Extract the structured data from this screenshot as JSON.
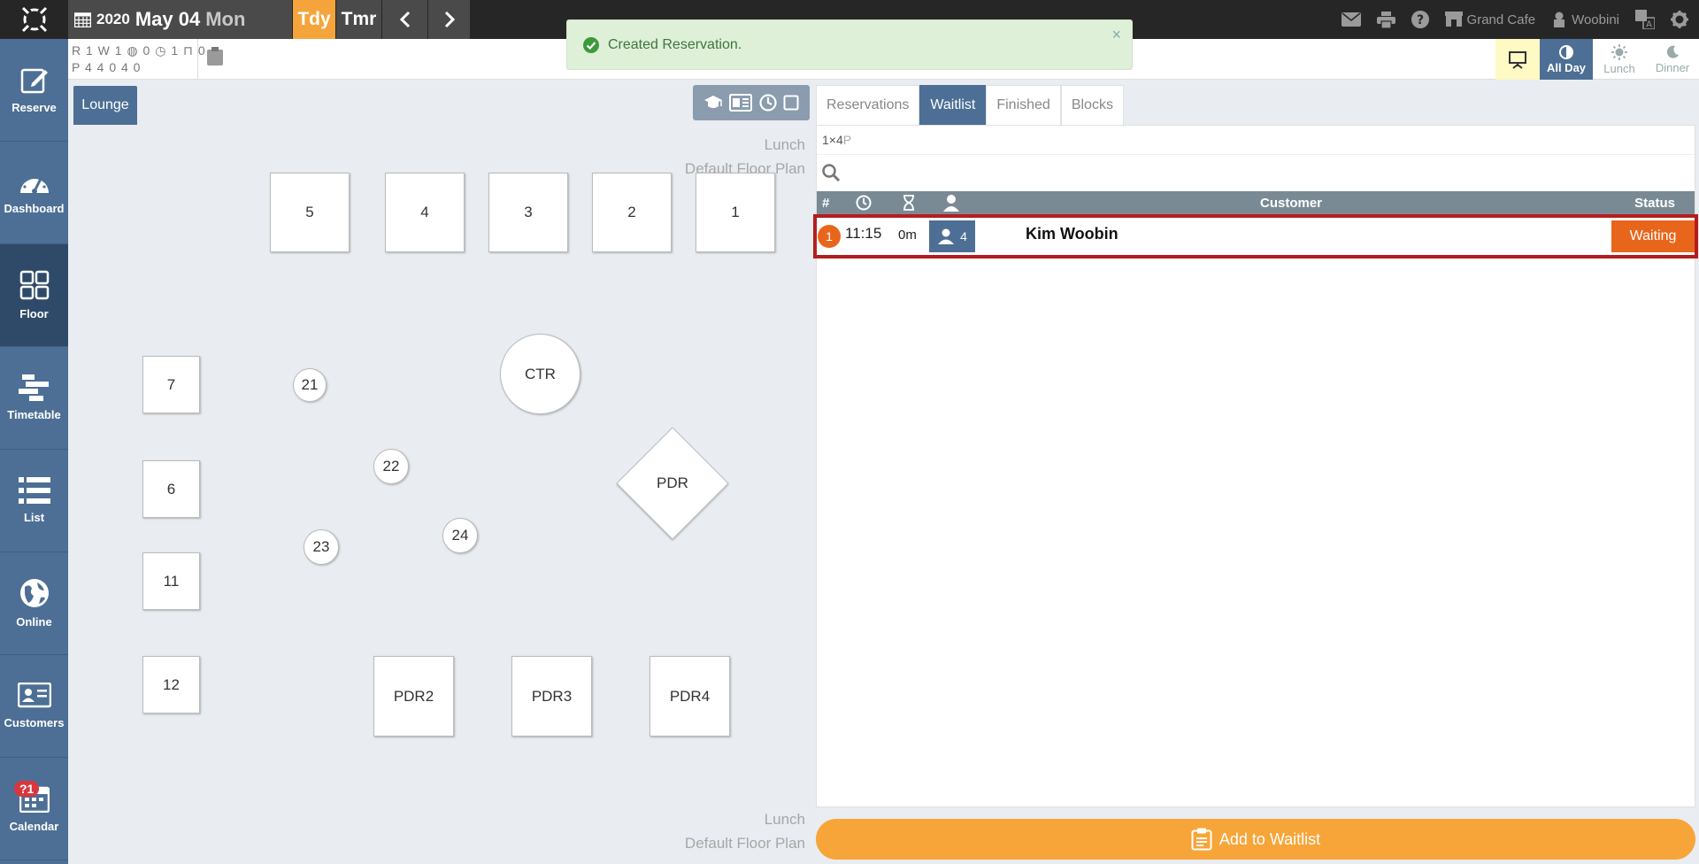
{
  "topbar": {
    "year": "2020",
    "month_day": "May 04",
    "weekday": "Mon",
    "today_label": "Tdy",
    "tomorrow_label": "Tmr",
    "restaurant": "Grand Cafe",
    "user": "Woobini"
  },
  "toast": {
    "message": "Created Reservation.",
    "close": "×"
  },
  "stats": {
    "row1": "R 1 W 1 ◍ 0 ◷ 1 ⊓ 0",
    "row2": "P 4   4   0   4   0"
  },
  "shifts": [
    {
      "label": "All Day",
      "active": true
    },
    {
      "label": "Lunch"
    },
    {
      "label": "Dinner"
    }
  ],
  "sidebar": {
    "items": [
      {
        "label": "Reserve"
      },
      {
        "label": "Dashboard"
      },
      {
        "label": "Floor",
        "active": true
      },
      {
        "label": "Timetable"
      },
      {
        "label": "List"
      },
      {
        "label": "Online"
      },
      {
        "label": "Customers"
      },
      {
        "label": "Calendar",
        "badge": "?1"
      }
    ]
  },
  "floor": {
    "room_tab": "Lounge",
    "shift_label": "Lunch",
    "plan_label": "Default Floor Plan",
    "tables": [
      "5",
      "4",
      "3",
      "2",
      "1",
      "7",
      "21",
      "CTR",
      "22",
      "PDR",
      "6",
      "24",
      "23",
      "11",
      "12",
      "PDR2",
      "PDR3",
      "PDR4"
    ]
  },
  "panel": {
    "tabs": [
      "Reservations",
      "Waitlist",
      "Finished",
      "Blocks"
    ],
    "active_tab": "Waitlist",
    "summary_count": "1×4",
    "summary_unit": "P",
    "search_placeholder": "",
    "columns": {
      "num": "#",
      "customer": "Customer",
      "status": "Status"
    },
    "rows": [
      {
        "num": "1",
        "time": "11:15",
        "duration": "0m",
        "party": "4",
        "customer": "Kim Woobin",
        "status": "Waiting"
      }
    ],
    "add_button": "Add to Waitlist"
  },
  "colors": {
    "accent": "#f7a538",
    "nav": "#4d6f95",
    "status": "#e8661c",
    "highlight": "#b51d1d"
  }
}
